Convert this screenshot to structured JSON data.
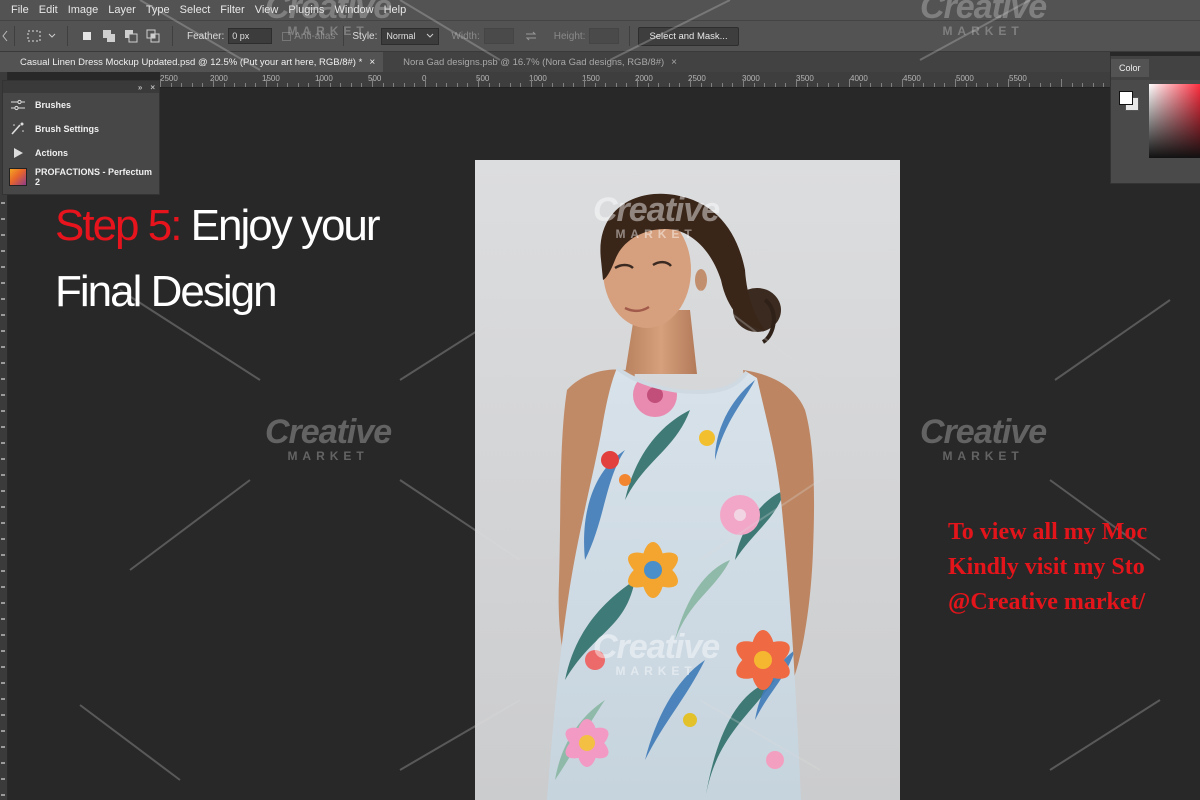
{
  "menu": [
    "File",
    "Edit",
    "Image",
    "Layer",
    "Type",
    "Select",
    "Filter",
    "View",
    "Plugins",
    "Window",
    "Help"
  ],
  "options": {
    "feather_label": "Feather:",
    "feather_value": "0 px",
    "antialias_label": "Anti-alias",
    "style_label": "Style:",
    "style_value": "Normal",
    "width_label": "Width:",
    "height_label": "Height:",
    "select_mask_label": "Select and Mask..."
  },
  "tabs": [
    {
      "label": "Casual Linen Dress Mockup Updated.psd @ 12.5% (Put your art here, RGB/8#) *",
      "close": "×"
    },
    {
      "label": "Nora Gad designs.psb @ 16.7% (Nora Gad designs, RGB/8#)",
      "close": "×"
    }
  ],
  "ruler": [
    "2500",
    "2000",
    "1500",
    "1000",
    "500",
    "0",
    "500",
    "1000",
    "1500",
    "2000",
    "2500",
    "3000",
    "3500",
    "4000",
    "4500",
    "5000",
    "5500"
  ],
  "panel": {
    "collapse": "»",
    "close": "×",
    "items": [
      "Brushes",
      "Brush Settings",
      "Actions",
      "PROFACTIONS - Perfectum 2"
    ]
  },
  "color_panel": {
    "title": "Color"
  },
  "overlay": {
    "step_prefix": "Step 5:",
    "step_line1": " Enjoy  your",
    "step_line2": "Final Design"
  },
  "promo": {
    "line1": "To view all my Moc",
    "line2": "Kindly visit my Sto",
    "line3": "@Creative market/"
  },
  "watermark": {
    "brand": "Creative",
    "sub": "MARKET"
  },
  "colors": {
    "accent_red": "#e8141d",
    "panel_bg": "#535353",
    "canvas_bg": "#282828"
  }
}
